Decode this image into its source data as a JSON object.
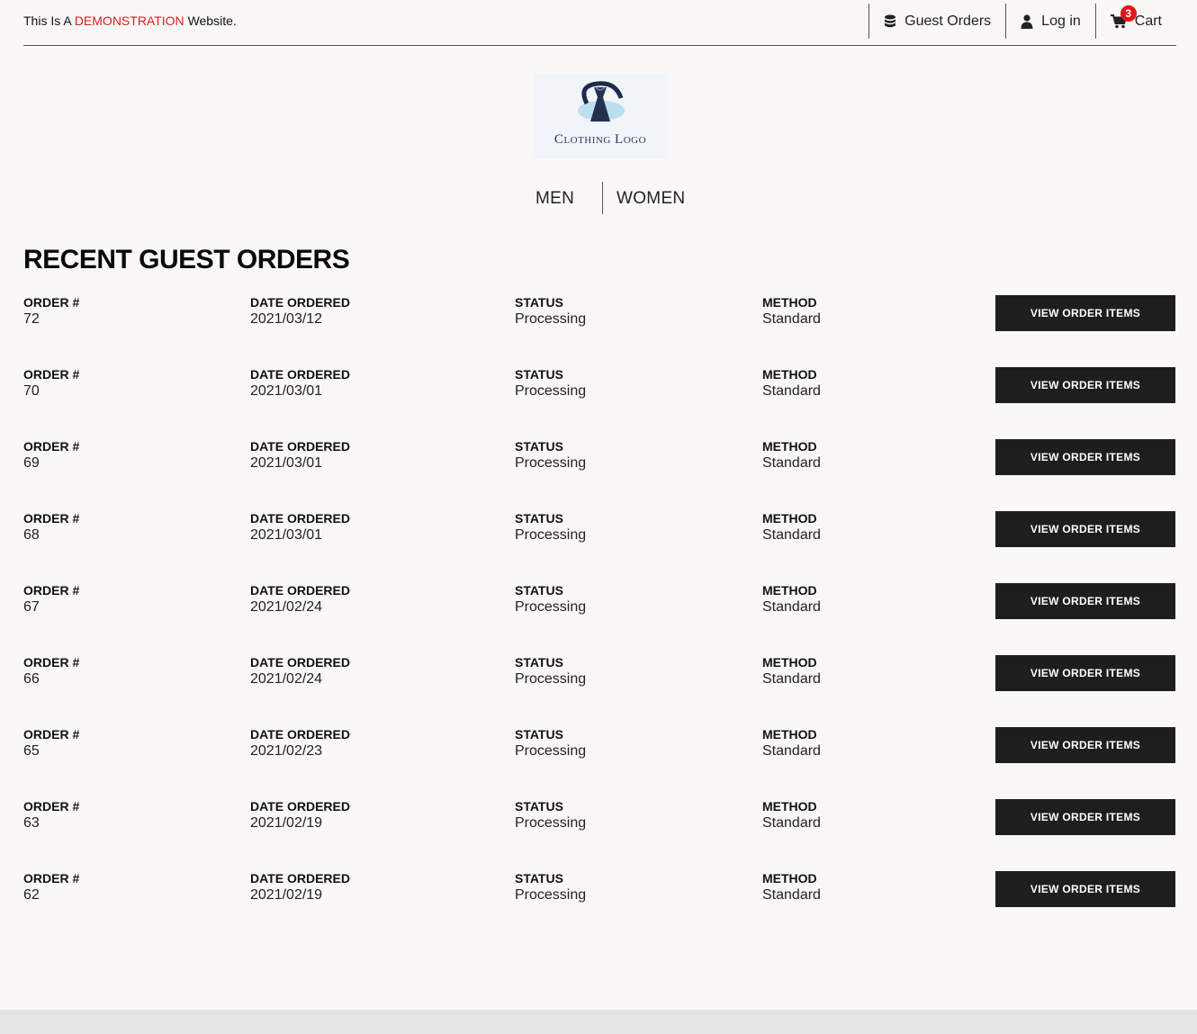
{
  "banner": {
    "prefix": "This Is A",
    "highlight": "DEMONSTRATION",
    "suffix": "Website."
  },
  "topnav": {
    "guest_orders": "Guest Orders",
    "login": "Log in",
    "cart": "Cart",
    "cart_count": "3"
  },
  "logo": {
    "text": "Clothing Logo"
  },
  "categories": {
    "men": "MEN",
    "women": "WOMEN"
  },
  "page_title": "RECENT GUEST ORDERS",
  "labels": {
    "order": "ORDER #",
    "date": "DATE ORDERED",
    "status": "STATUS",
    "method": "METHOD",
    "button": "VIEW ORDER ITEMS"
  },
  "orders": [
    {
      "number": "72",
      "date": "2021/03/12",
      "status": "Processing",
      "method": "Standard"
    },
    {
      "number": "70",
      "date": "2021/03/01",
      "status": "Processing",
      "method": "Standard"
    },
    {
      "number": "69",
      "date": "2021/03/01",
      "status": "Processing",
      "method": "Standard"
    },
    {
      "number": "68",
      "date": "2021/03/01",
      "status": "Processing",
      "method": "Standard"
    },
    {
      "number": "67",
      "date": "2021/02/24",
      "status": "Processing",
      "method": "Standard"
    },
    {
      "number": "66",
      "date": "2021/02/24",
      "status": "Processing",
      "method": "Standard"
    },
    {
      "number": "65",
      "date": "2021/02/23",
      "status": "Processing",
      "method": "Standard"
    },
    {
      "number": "63",
      "date": "2021/02/19",
      "status": "Processing",
      "method": "Standard"
    },
    {
      "number": "62",
      "date": "2021/02/19",
      "status": "Processing",
      "method": "Standard"
    }
  ],
  "colors": {
    "accent": "#d81e1e",
    "button_bg": "#1e1e1e",
    "badge": "#e3141b",
    "page_bg": "#faf8f6"
  }
}
